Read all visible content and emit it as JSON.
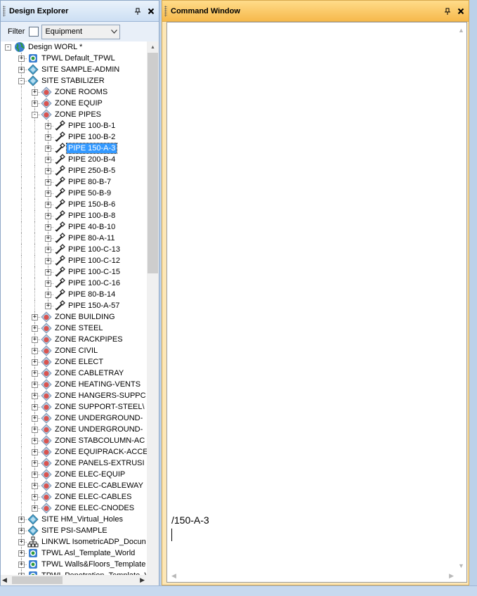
{
  "explorer": {
    "title": "Design Explorer",
    "filter_label": "Filter",
    "filter_value": "Equipment",
    "tree": [
      {
        "label": "Design WORL *",
        "depth": 0,
        "icon": "globe-icon",
        "toggle": "-"
      },
      {
        "label": "TPWL Default_TPWL",
        "depth": 1,
        "icon": "world-icon",
        "toggle": "+"
      },
      {
        "label": "SITE SAMPLE-ADMIN",
        "depth": 1,
        "icon": "site-icon",
        "toggle": "+"
      },
      {
        "label": "SITE STABILIZER",
        "depth": 1,
        "icon": "site-icon",
        "toggle": "-"
      },
      {
        "label": "ZONE ROOMS",
        "depth": 2,
        "icon": "zone-icon",
        "toggle": "+"
      },
      {
        "label": "ZONE EQUIP",
        "depth": 2,
        "icon": "zone-icon",
        "toggle": "+"
      },
      {
        "label": "ZONE PIPES",
        "depth": 2,
        "icon": "zone-icon",
        "toggle": "-"
      },
      {
        "label": "PIPE 100-B-1",
        "depth": 3,
        "icon": "pipe-icon",
        "toggle": "+"
      },
      {
        "label": "PIPE 100-B-2",
        "depth": 3,
        "icon": "pipe-icon",
        "toggle": "+"
      },
      {
        "label": "PIPE 150-A-3",
        "depth": 3,
        "icon": "pipe-icon",
        "toggle": "+",
        "selected": true
      },
      {
        "label": "PIPE 200-B-4",
        "depth": 3,
        "icon": "pipe-icon",
        "toggle": "+"
      },
      {
        "label": "PIPE 250-B-5",
        "depth": 3,
        "icon": "pipe-icon",
        "toggle": "+"
      },
      {
        "label": "PIPE 80-B-7",
        "depth": 3,
        "icon": "pipe-icon",
        "toggle": "+"
      },
      {
        "label": "PIPE 50-B-9",
        "depth": 3,
        "icon": "pipe-icon",
        "toggle": "+"
      },
      {
        "label": "PIPE 150-B-6",
        "depth": 3,
        "icon": "pipe-icon",
        "toggle": "+"
      },
      {
        "label": "PIPE 100-B-8",
        "depth": 3,
        "icon": "pipe-icon",
        "toggle": "+"
      },
      {
        "label": "PIPE 40-B-10",
        "depth": 3,
        "icon": "pipe-icon",
        "toggle": "+"
      },
      {
        "label": "PIPE 80-A-11",
        "depth": 3,
        "icon": "pipe-icon",
        "toggle": "+"
      },
      {
        "label": "PIPE 100-C-13",
        "depth": 3,
        "icon": "pipe-icon",
        "toggle": "+"
      },
      {
        "label": "PIPE 100-C-12",
        "depth": 3,
        "icon": "pipe-icon",
        "toggle": "+"
      },
      {
        "label": "PIPE 100-C-15",
        "depth": 3,
        "icon": "pipe-icon",
        "toggle": "+"
      },
      {
        "label": "PIPE 100-C-16",
        "depth": 3,
        "icon": "pipe-icon",
        "toggle": "+"
      },
      {
        "label": "PIPE 80-B-14",
        "depth": 3,
        "icon": "pipe-icon",
        "toggle": "+"
      },
      {
        "label": "PIPE 150-A-57",
        "depth": 3,
        "icon": "pipe-icon",
        "toggle": "+",
        "last": true
      },
      {
        "label": "ZONE BUILDING",
        "depth": 2,
        "icon": "zone-icon",
        "toggle": "+"
      },
      {
        "label": "ZONE STEEL",
        "depth": 2,
        "icon": "zone-icon",
        "toggle": "+"
      },
      {
        "label": "ZONE RACKPIPES",
        "depth": 2,
        "icon": "zone-icon",
        "toggle": "+"
      },
      {
        "label": "ZONE CIVIL",
        "depth": 2,
        "icon": "zone-icon",
        "toggle": "+"
      },
      {
        "label": "ZONE ELECT",
        "depth": 2,
        "icon": "zone-icon",
        "toggle": "+"
      },
      {
        "label": "ZONE CABLETRAY",
        "depth": 2,
        "icon": "zone-icon",
        "toggle": "+"
      },
      {
        "label": "ZONE HEATING-VENTS",
        "depth": 2,
        "icon": "zone-icon",
        "toggle": "+"
      },
      {
        "label": "ZONE HANGERS-SUPPC",
        "depth": 2,
        "icon": "zone-icon",
        "toggle": "+"
      },
      {
        "label": "ZONE SUPPORT-STEEL\\",
        "depth": 2,
        "icon": "zone-icon",
        "toggle": "+"
      },
      {
        "label": "ZONE UNDERGROUND-",
        "depth": 2,
        "icon": "zone-icon",
        "toggle": "+"
      },
      {
        "label": "ZONE UNDERGROUND-",
        "depth": 2,
        "icon": "zone-icon",
        "toggle": "+"
      },
      {
        "label": "ZONE STABCOLUMN-AC",
        "depth": 2,
        "icon": "zone-icon",
        "toggle": "+"
      },
      {
        "label": "ZONE EQUIPRACK-ACCE",
        "depth": 2,
        "icon": "zone-icon",
        "toggle": "+"
      },
      {
        "label": "ZONE PANELS-EXTRUSI",
        "depth": 2,
        "icon": "zone-icon",
        "toggle": "+"
      },
      {
        "label": "ZONE ELEC-EQUIP",
        "depth": 2,
        "icon": "zone-icon",
        "toggle": "+"
      },
      {
        "label": "ZONE ELEC-CABLEWAY",
        "depth": 2,
        "icon": "zone-icon",
        "toggle": "+"
      },
      {
        "label": "ZONE ELEC-CABLES",
        "depth": 2,
        "icon": "zone-icon",
        "toggle": "+"
      },
      {
        "label": "ZONE ELEC-CNODES",
        "depth": 2,
        "icon": "zone-icon",
        "toggle": "+",
        "last": true
      },
      {
        "label": "SITE HM_Virtual_Holes",
        "depth": 1,
        "icon": "site-icon",
        "toggle": "+"
      },
      {
        "label": "SITE PSI-SAMPLE",
        "depth": 1,
        "icon": "site-icon",
        "toggle": "+"
      },
      {
        "label": "LINKWL IsometricADP_Docun",
        "depth": 1,
        "icon": "link-icon",
        "toggle": "+"
      },
      {
        "label": "TPWL Asl_Template_World",
        "depth": 1,
        "icon": "world-icon",
        "toggle": "+"
      },
      {
        "label": "TPWL Walls&Floors_Template",
        "depth": 1,
        "icon": "world-icon",
        "toggle": "+"
      },
      {
        "label": "TPWL Penetration_Template_V",
        "depth": 1,
        "icon": "world-icon",
        "toggle": "+"
      }
    ]
  },
  "command": {
    "title": "Command Window",
    "output_lines": [
      "/150-A-3"
    ]
  },
  "colors": {
    "selection": "#3399ff",
    "command_header": "#f6b94c",
    "explorer_header": "#cddff3",
    "globe": "#2f9a3a",
    "site": "#4a9fc9",
    "zone": "#d9534f"
  }
}
